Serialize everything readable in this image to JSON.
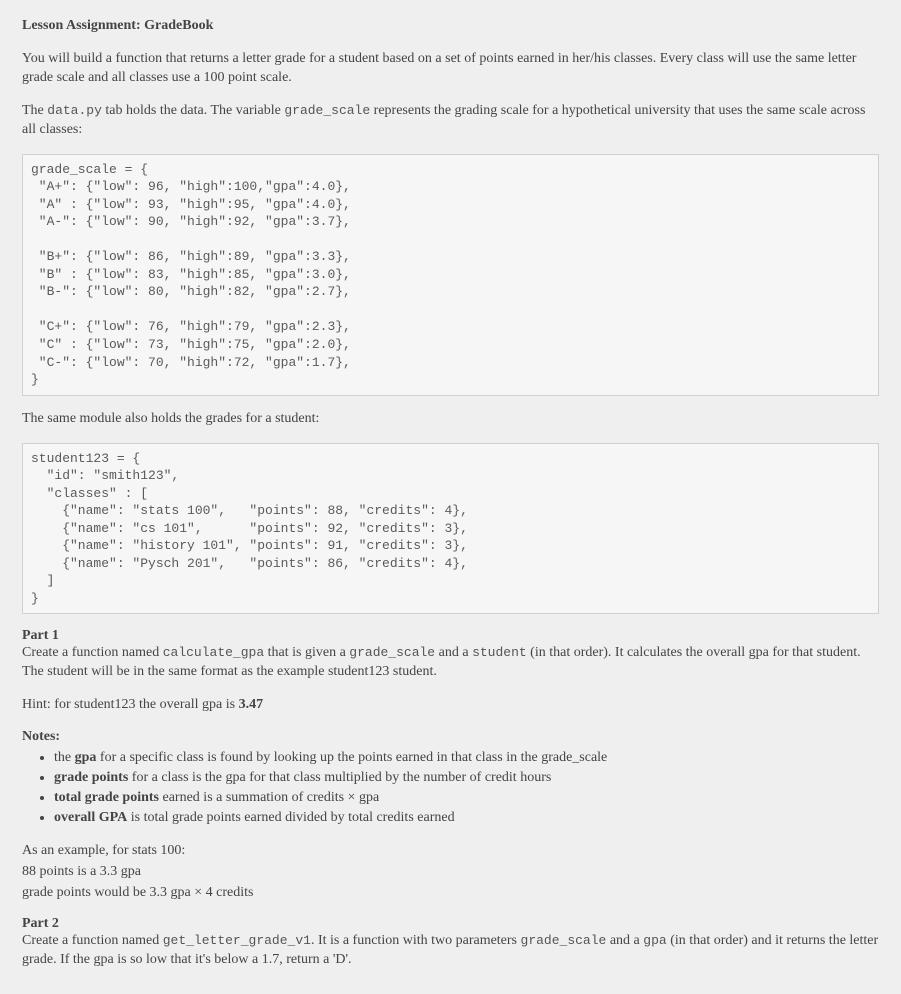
{
  "title": "Lesson Assignment:  GradeBook",
  "intro_p1": "You will build a function that returns a letter grade for a student based on a set of points earned in her/his classes.  Every class will use the same letter grade scale and all classes use a 100 point scale.",
  "intro_p2_a": "The ",
  "intro_p2_code1": "data.py",
  "intro_p2_b": " tab holds the data. The variable ",
  "intro_p2_code2": "grade_scale",
  "intro_p2_c": " represents the grading scale for a hypothetical university that uses the same scale across all classes:",
  "code_block_1": "grade_scale = {\n \"A+\": {\"low\": 96, \"high\":100,\"gpa\":4.0},\n \"A\" : {\"low\": 93, \"high\":95, \"gpa\":4.0},\n \"A-\": {\"low\": 90, \"high\":92, \"gpa\":3.7},\n\n \"B+\": {\"low\": 86, \"high\":89, \"gpa\":3.3},\n \"B\" : {\"low\": 83, \"high\":85, \"gpa\":3.0},\n \"B-\": {\"low\": 80, \"high\":82, \"gpa\":2.7},\n\n \"C+\": {\"low\": 76, \"high\":79, \"gpa\":2.3},\n \"C\" : {\"low\": 73, \"high\":75, \"gpa\":2.0},\n \"C-\": {\"low\": 70, \"high\":72, \"gpa\":1.7},\n}",
  "mid_p": "The same module also holds the grades for a student:",
  "code_block_2": "student123 = {\n  \"id\": \"smith123\",\n  \"classes\" : [\n    {\"name\": \"stats 100\",   \"points\": 88, \"credits\": 4},\n    {\"name\": \"cs 101\",      \"points\": 92, \"credits\": 3},\n    {\"name\": \"history 101\", \"points\": 91, \"credits\": 3},\n    {\"name\": \"Pysch 201\",   \"points\": 86, \"credits\": 4},\n  ]\n}",
  "part1_head": "Part 1",
  "part1_a": "Create a function named ",
  "part1_code1": "calculate_gpa",
  "part1_b": " that is given a ",
  "part1_code2": "grade_scale",
  "part1_c": " and a ",
  "part1_code3": "student",
  "part1_d": " (in that order).  It calculates the overall gpa for that student.  The student will be in the same format as the example student123 student.",
  "hint_a": "Hint: for student123 the overall gpa is ",
  "hint_b": "3.47",
  "notes_head": "Notes:",
  "note1_a": "the ",
  "note1_b": "gpa",
  "note1_c": " for a specific class is found by looking up the points earned in that class in the grade_scale",
  "note2_a": "grade points",
  "note2_b": " for a class is the gpa for that class multiplied by the number of credit hours",
  "note3_a": "total grade points",
  "note3_b": " earned is a summation of credits × gpa",
  "note4_a": "overall GPA",
  "note4_b": " is total grade points earned divided by total credits earned",
  "example_p1": "As an example, for stats 100:",
  "example_p2": "88 points is a 3.3 gpa",
  "example_p3": "grade points would be 3.3 gpa × 4 credits",
  "part2_head": "Part 2",
  "part2_a": "Create a function named ",
  "part2_code1": "get_letter_grade_v1",
  "part2_b": ".  It is a function with two parameters ",
  "part2_code2": "grade_scale",
  "part2_c": " and a ",
  "part2_code3": "gpa",
  "part2_d": " (in that order) and it returns the letter grade.  If the gpa is so low that it's below a 1.7, return a 'D'."
}
